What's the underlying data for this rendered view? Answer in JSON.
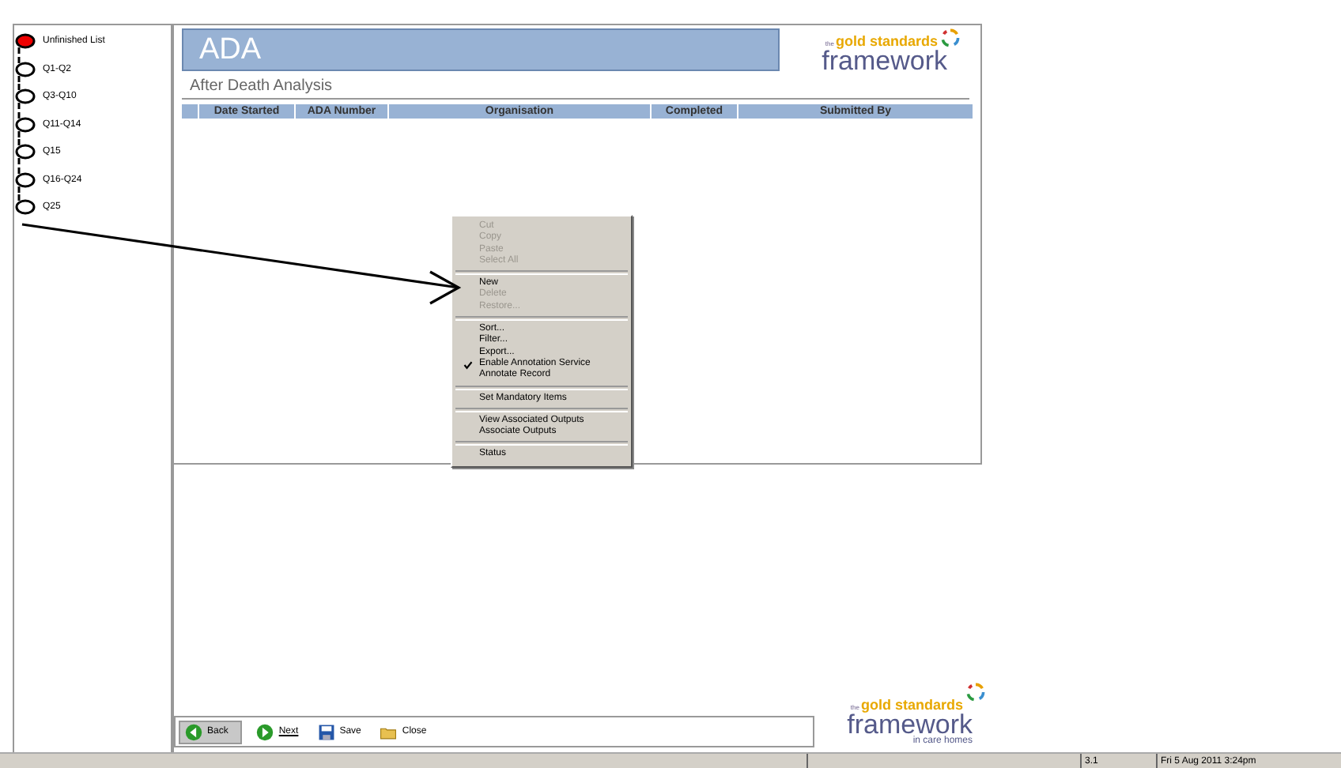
{
  "steps": [
    {
      "label": "Unfinished List",
      "selected": true
    },
    {
      "label": "Q1-Q2",
      "selected": false
    },
    {
      "label": "Q3-Q10",
      "selected": false
    },
    {
      "label": "Q11-Q14",
      "selected": false
    },
    {
      "label": "Q15",
      "selected": false
    },
    {
      "label": "Q16-Q24",
      "selected": false
    },
    {
      "label": "Q25",
      "selected": false
    }
  ],
  "header": {
    "title": "ADA",
    "subtitle": "After Death Analysis"
  },
  "logo": {
    "the": "the",
    "line1": "gold standards",
    "line2": "framework"
  },
  "table": {
    "columns": [
      "Date Started",
      "ADA Number",
      "Organisation",
      "Completed",
      "Submitted By"
    ]
  },
  "context_menu": [
    {
      "kind": "item",
      "label": "Cut",
      "disabled": true,
      "checked": false
    },
    {
      "kind": "item",
      "label": "Copy",
      "disabled": true,
      "checked": false
    },
    {
      "kind": "item",
      "label": "Paste",
      "disabled": true,
      "checked": false
    },
    {
      "kind": "item",
      "label": "Select All",
      "disabled": true,
      "checked": false
    },
    {
      "kind": "separator"
    },
    {
      "kind": "item",
      "label": "New",
      "disabled": false,
      "checked": false
    },
    {
      "kind": "item",
      "label": "Delete",
      "disabled": true,
      "checked": false
    },
    {
      "kind": "item",
      "label": "Restore...",
      "disabled": true,
      "checked": false
    },
    {
      "kind": "separator"
    },
    {
      "kind": "item",
      "label": "Sort...",
      "disabled": false,
      "checked": false
    },
    {
      "kind": "item",
      "label": "Filter...",
      "disabled": false,
      "checked": false
    },
    {
      "kind": "item",
      "label": "Export...",
      "disabled": false,
      "checked": false
    },
    {
      "kind": "item",
      "label": "Enable Annotation Service",
      "disabled": false,
      "checked": true
    },
    {
      "kind": "item",
      "label": "Annotate Record",
      "disabled": false,
      "checked": false
    },
    {
      "kind": "separator"
    },
    {
      "kind": "item",
      "label": "Set Mandatory Items",
      "disabled": false,
      "checked": false
    },
    {
      "kind": "separator"
    },
    {
      "kind": "item",
      "label": "View Associated Outputs",
      "disabled": false,
      "checked": false
    },
    {
      "kind": "item",
      "label": "Associate Outputs",
      "disabled": false,
      "checked": false
    },
    {
      "kind": "separator"
    },
    {
      "kind": "item",
      "label": "Status",
      "disabled": false,
      "checked": false
    }
  ],
  "toolbar": [
    {
      "kind": "back",
      "label": "Back"
    },
    {
      "kind": "next",
      "label": "Next"
    },
    {
      "kind": "save",
      "label": "Save"
    },
    {
      "kind": "close",
      "label": "Close"
    }
  ],
  "footer_logo": {
    "the": "the",
    "line1": "gold standards",
    "line2": "framework",
    "line3": "in care homes"
  },
  "status_bar": [
    "3.1",
    "Fri 5 Aug 2011 3:24pm"
  ]
}
